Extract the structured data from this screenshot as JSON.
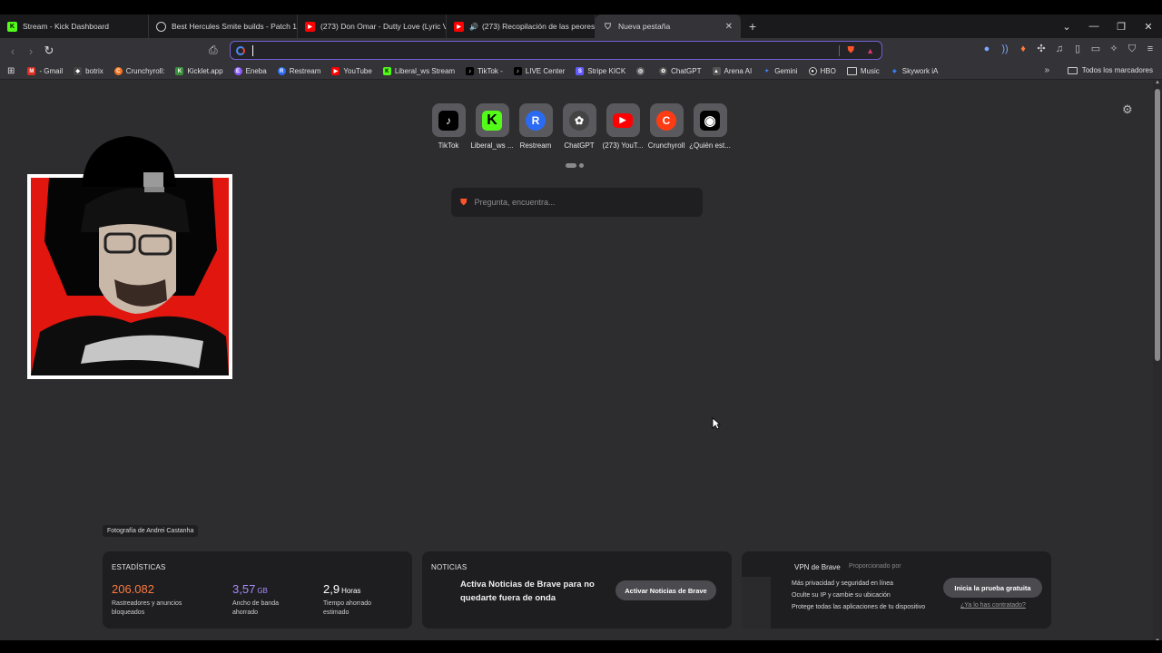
{
  "tabs": [
    {
      "title": "Stream - Kick Dashboard",
      "icon": "kick-icon",
      "color": "#53fc18"
    },
    {
      "title": "Best Hercules Smite builds - Patch 12",
      "icon": "smite-icon",
      "color": "#888888"
    },
    {
      "title": "(273) Don Omar - Dutty Love (Lyric V",
      "icon": "youtube-icon",
      "color": "#ff0000"
    },
    {
      "title": "(273) Recopilación de las peores",
      "icon": "youtube-icon",
      "color": "#ff0000"
    },
    {
      "title": "Nueva pestaña",
      "icon": "brave-shield-icon",
      "color": "#888888",
      "active": true
    }
  ],
  "bookmarks": [
    {
      "label": "- Gmail",
      "color": "#d93025",
      "glyph": "M"
    },
    {
      "label": "botrix",
      "color": "#444444",
      "glyph": "◆"
    },
    {
      "label": "Crunchyroll:",
      "color": "#f47521",
      "glyph": "C"
    },
    {
      "label": "Kicklet.app",
      "color": "#3a8f3a",
      "glyph": "K"
    },
    {
      "label": "Eneba",
      "color": "#8b5cf6",
      "glyph": "E"
    },
    {
      "label": "Restream",
      "color": "#2b6bf3",
      "glyph": "R"
    },
    {
      "label": "YouTube",
      "color": "#ff0000",
      "glyph": "▶"
    },
    {
      "label": "Liberal_ws Stream",
      "color": "#53fc18",
      "glyph": "K"
    },
    {
      "label": "TikTok -",
      "color": "#000000",
      "glyph": "♪"
    },
    {
      "label": "LIVE Center",
      "color": "#000000",
      "glyph": "♪"
    },
    {
      "label": "Stripe KICK",
      "color": "#635bff",
      "glyph": "S"
    },
    {
      "label": "",
      "color": "#666666",
      "glyph": "◎"
    },
    {
      "label": "ChatGPT",
      "color": "#555555",
      "glyph": "✿"
    },
    {
      "label": "Arena AI",
      "color": "#555555",
      "glyph": "▲"
    },
    {
      "label": "Gemini",
      "color": "#4285f4",
      "glyph": "✦"
    },
    {
      "label": "HBO",
      "color": "#222222",
      "glyph": "●"
    },
    {
      "label": "Music",
      "color": "#777777",
      "glyph": "▭"
    },
    {
      "label": "Skywork iA",
      "color": "#3b82f6",
      "glyph": "◈"
    }
  ],
  "bookmarks_all": "Todos los marcadores",
  "topsites": [
    {
      "label": "TikTok",
      "color": "#000000",
      "glyph": "♪"
    },
    {
      "label": "Liberal_ws ...",
      "color": "#53fc18",
      "glyph": "K"
    },
    {
      "label": "Restream",
      "color": "#2b6bf3",
      "glyph": "R"
    },
    {
      "label": "ChatGPT",
      "color": "#444444",
      "glyph": "✿"
    },
    {
      "label": "(273) YouT...",
      "color": "#ff0000",
      "glyph": "▶"
    },
    {
      "label": "Crunchyroll",
      "color": "#ff3b14",
      "glyph": "C"
    },
    {
      "label": "¿Quién est...",
      "color": "#000000",
      "glyph": "◉"
    }
  ],
  "search": {
    "placeholder": "Pregunta, encuentra..."
  },
  "photo_credit": "Fotografía de Andrei Castanha",
  "stats": {
    "title": "ESTADÍSTICAS",
    "blocked": {
      "num": "206.082",
      "unit": "",
      "desc": "Rastreadores y anuncios bloqueados",
      "color": "#ff7a3d"
    },
    "bandwidth": {
      "num": "3,57",
      "unit": "GB",
      "desc": "Ancho de banda ahorrado",
      "color": "#a78bfa"
    },
    "time": {
      "num": "2,9",
      "unit": "Horas",
      "desc": "Tiempo ahorrado estimado",
      "color": "#ffffff"
    }
  },
  "news": {
    "title": "NOTICIAS",
    "text": "Activa Noticias de Brave para no quedarte fuera de onda",
    "button": "Activar Noticias de Brave"
  },
  "vpn": {
    "title": "VPN de Brave",
    "provider": "Proporcionado por",
    "lines": [
      "Más privacidad y seguridad en línea",
      "Oculte su IP y cambie su ubicación",
      "Protege todas las aplicaciones de tu dispositivo"
    ],
    "button": "Inicia la prueba gratuita",
    "link": "¿Ya lo has contratado?"
  }
}
